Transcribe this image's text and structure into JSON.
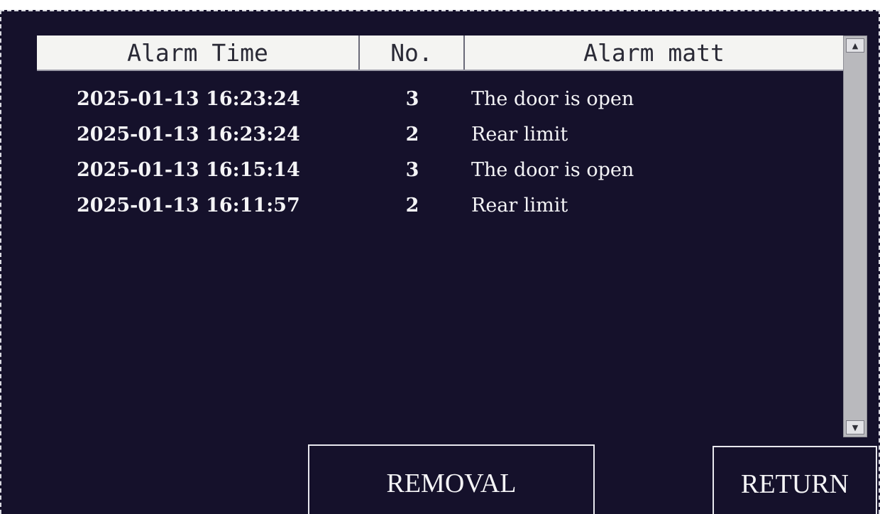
{
  "table": {
    "headers": {
      "time": "Alarm Time",
      "no": "No.",
      "matter": "Alarm matt"
    },
    "rows": [
      {
        "time": "2025-01-13 16:23:24",
        "no": "3",
        "matter": "The door is open"
      },
      {
        "time": "2025-01-13 16:23:24",
        "no": "2",
        "matter": "Rear limit"
      },
      {
        "time": "2025-01-13 16:15:14",
        "no": "3",
        "matter": "The door is open"
      },
      {
        "time": "2025-01-13 16:11:57",
        "no": "2",
        "matter": "Rear limit"
      }
    ]
  },
  "scrollbar": {
    "up_icon": "arrow-up-icon",
    "down_icon": "arrow-down-icon"
  },
  "buttons": {
    "removal": "REMOVAL",
    "return": "RETURN"
  },
  "colors": {
    "background": "#15112b",
    "text": "#f4f4f6",
    "header_bg": "#f4f4f2"
  }
}
